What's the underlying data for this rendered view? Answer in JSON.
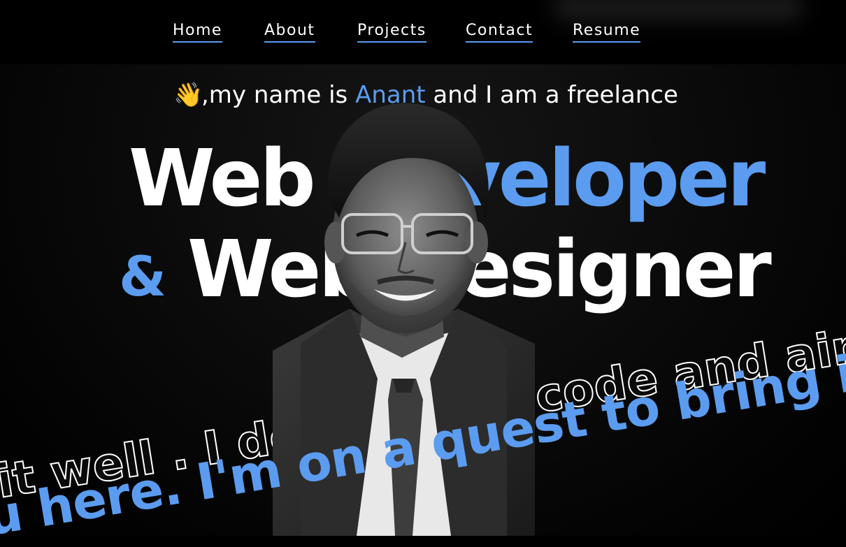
{
  "nav": {
    "items": [
      {
        "label": "Home"
      },
      {
        "label": "About"
      },
      {
        "label": "Projects"
      },
      {
        "label": "Contact"
      },
      {
        "label": "Resume"
      }
    ]
  },
  "hero": {
    "intro_wave": "👋",
    "intro_prefix": ",my name is ",
    "intro_name": "Anant",
    "intro_suffix": " and I am a freelance",
    "line1_word1": "Web",
    "line1_word2": "Developer",
    "ampersand": "&",
    "line2_word1": "Web",
    "line2_word2": "Designer"
  },
  "marquee": {
    "outline_text": "it well . I design and code and aims to",
    "blue_text": "u here. I'm on a quest to bring ideas t"
  },
  "colors": {
    "accent": "#5b9cf0",
    "background": "#000000"
  }
}
